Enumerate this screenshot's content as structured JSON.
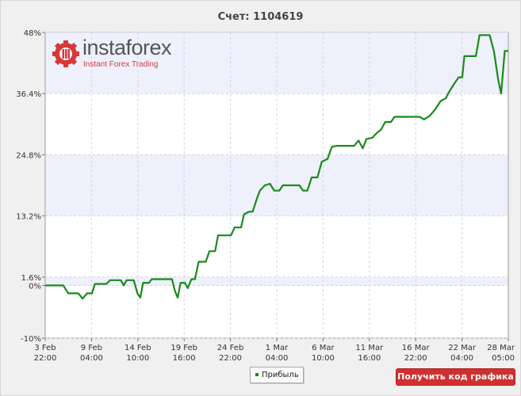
{
  "header": {
    "title": "Счет: 1104619"
  },
  "logo": {
    "wordmark": "instaforex",
    "tagline": "Instant Forex Trading",
    "icon": "gear-logo-icon"
  },
  "legend": {
    "label": "Прибыль",
    "color": "#1a8a1a"
  },
  "actions": {
    "get_code_label": "Получить код графика",
    "get_code_color": "#d03030"
  },
  "chart_data": {
    "type": "line",
    "title": "Счет: 1104619",
    "xlabel": "",
    "ylabel": "",
    "y_ticks": [
      "48%",
      "36.4%",
      "24.8%",
      "13.2%",
      "1.6%",
      "0%",
      "-10%"
    ],
    "y_tick_values": [
      48,
      36.4,
      24.8,
      13.2,
      1.6,
      0,
      -10
    ],
    "ylim": [
      -10,
      48
    ],
    "x_ticks": [
      {
        "date": "3 Feb",
        "time": "22:00"
      },
      {
        "date": "9 Feb",
        "time": "04:00"
      },
      {
        "date": "14 Feb",
        "time": "10:00"
      },
      {
        "date": "19 Feb",
        "time": "16:00"
      },
      {
        "date": "24 Feb",
        "time": "22:00"
      },
      {
        "date": "1 Mar",
        "time": "04:00"
      },
      {
        "date": "6 Mar",
        "time": "10:00"
      },
      {
        "date": "11 Mar",
        "time": "16:00"
      },
      {
        "date": "16 Mar",
        "time": "22:00"
      },
      {
        "date": "22 Mar",
        "time": "04:00"
      },
      {
        "date": "28 Mar",
        "time": "05:00"
      }
    ],
    "grid": true,
    "band_color": "#eef0fb",
    "series": [
      {
        "name": "Прибыль",
        "color": "#1a8a1a",
        "points": [
          [
            0,
            0
          ],
          [
            2.5,
            0
          ],
          [
            3.2,
            -1.5
          ],
          [
            4.6,
            -1.5
          ],
          [
            5.2,
            -2.5
          ],
          [
            5.8,
            -1.5
          ],
          [
            6.5,
            -1.5
          ],
          [
            6.9,
            0.3
          ],
          [
            8.5,
            0.3
          ],
          [
            9.0,
            1.0
          ],
          [
            10.5,
            1.0
          ],
          [
            10.9,
            0.0
          ],
          [
            11.3,
            1.0
          ],
          [
            12.3,
            1.0
          ],
          [
            12.8,
            -1.5
          ],
          [
            13.2,
            -2.3
          ],
          [
            13.6,
            0.5
          ],
          [
            14.4,
            0.5
          ],
          [
            14.8,
            1.2
          ],
          [
            17.6,
            1.2
          ],
          [
            18.0,
            -1.0
          ],
          [
            18.4,
            -2.3
          ],
          [
            18.8,
            0.5
          ],
          [
            19.4,
            0.5
          ],
          [
            19.8,
            -0.5
          ],
          [
            20.3,
            1.2
          ],
          [
            20.8,
            1.2
          ],
          [
            21.3,
            4.5
          ],
          [
            22.3,
            4.5
          ],
          [
            22.8,
            6.5
          ],
          [
            23.6,
            6.5
          ],
          [
            24.0,
            9.5
          ],
          [
            25.8,
            9.5
          ],
          [
            26.3,
            11.0
          ],
          [
            27.2,
            11.0
          ],
          [
            27.6,
            13.5
          ],
          [
            28.3,
            14.0
          ],
          [
            28.8,
            14.0
          ],
          [
            29.4,
            16.5
          ],
          [
            29.8,
            18.0
          ],
          [
            30.5,
            19.0
          ],
          [
            31.2,
            19.3
          ],
          [
            31.8,
            18.0
          ],
          [
            32.5,
            18.0
          ],
          [
            33.0,
            19.0
          ],
          [
            35.3,
            19.0
          ],
          [
            35.8,
            18.0
          ],
          [
            36.4,
            18.0
          ],
          [
            37.0,
            20.5
          ],
          [
            37.8,
            20.5
          ],
          [
            38.4,
            23.5
          ],
          [
            39.2,
            24.0
          ],
          [
            39.8,
            26.3
          ],
          [
            40.5,
            26.5
          ],
          [
            42.9,
            26.5
          ],
          [
            43.5,
            27.5
          ],
          [
            44.1,
            26.0
          ],
          [
            44.6,
            27.8
          ],
          [
            45.4,
            28.0
          ],
          [
            46.1,
            29.0
          ],
          [
            46.6,
            29.5
          ],
          [
            47.2,
            31.0
          ],
          [
            48.0,
            31.0
          ],
          [
            48.5,
            32.0
          ],
          [
            52.0,
            32.0
          ],
          [
            52.6,
            31.5
          ],
          [
            53.4,
            32.2
          ],
          [
            54.2,
            33.5
          ],
          [
            54.9,
            35.0
          ],
          [
            55.6,
            35.5
          ],
          [
            56.2,
            37.0
          ],
          [
            56.9,
            38.5
          ],
          [
            57.4,
            39.5
          ],
          [
            57.9,
            39.5
          ],
          [
            58.2,
            43.5
          ],
          [
            59.8,
            43.5
          ],
          [
            60.3,
            47.5
          ],
          [
            61.7,
            47.5
          ],
          [
            62.3,
            44.5
          ],
          [
            62.9,
            39.0
          ],
          [
            63.3,
            36.4
          ],
          [
            63.8,
            44.5
          ],
          [
            64.3,
            44.5
          ]
        ]
      }
    ]
  }
}
